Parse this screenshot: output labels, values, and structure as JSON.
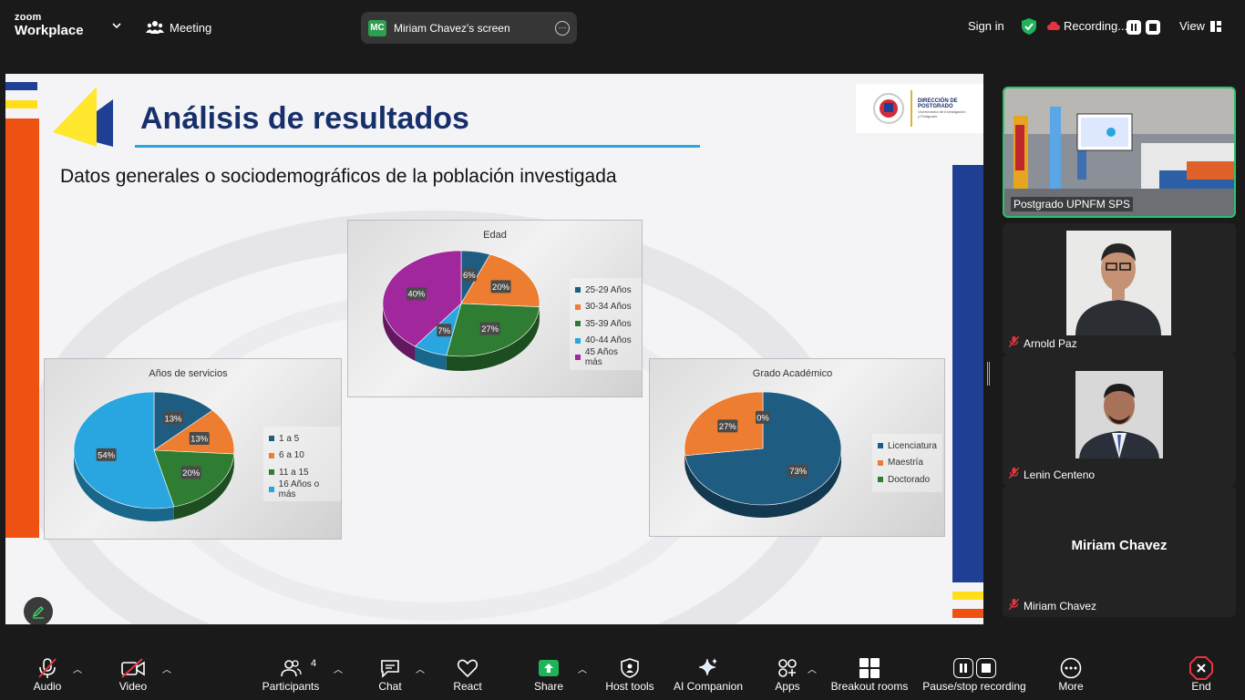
{
  "topbar": {
    "brand_top": "zoom",
    "brand_bottom": "Workplace",
    "meeting_label": "Meeting",
    "screen_initials": "MC",
    "screen_label": "Miriam Chavez's screen",
    "sign_in": "Sign in",
    "recording_label": "Recording...",
    "view_label": "View"
  },
  "slide": {
    "title": "Análisis de resultados",
    "subtitle": "Datos generales o sociodemográficos de la población investigada",
    "logo_line1": "DIRECCIÓN DE",
    "logo_line2": "POSTGRADO",
    "logo_line3": "Vicerrectoría de Investigación",
    "logo_line4": "y Postgrado"
  },
  "chart_data": [
    {
      "type": "pie",
      "title": "Edad",
      "categories": [
        "25-29 Años",
        "30-34 Años",
        "35-39 Años",
        "40-44 Años",
        "45 Años más"
      ],
      "values": [
        6,
        20,
        27,
        7,
        40
      ],
      "labels": [
        "6%",
        "20%",
        "27%",
        "7%",
        "40%"
      ],
      "colors": [
        "#1f5c82",
        "#ed7d31",
        "#2e7d32",
        "#29a6e0",
        "#a0289c"
      ],
      "legend": "right"
    },
    {
      "type": "pie",
      "title": "Años de servicios",
      "categories": [
        "1 a 5",
        "6 a 10",
        "11 a 15",
        "16 Años o más"
      ],
      "values": [
        13,
        13,
        20,
        54
      ],
      "labels": [
        "13%",
        "13%",
        "20%",
        "54%"
      ],
      "colors": [
        "#1f5c82",
        "#ed7d31",
        "#2e7d32",
        "#29a6e0"
      ],
      "legend": "right"
    },
    {
      "type": "pie",
      "title": "Grado Académico",
      "categories": [
        "Licenciatura",
        "Maestría",
        "Doctorado"
      ],
      "values": [
        73,
        27,
        0
      ],
      "labels": [
        "73%",
        "27%",
        "0%"
      ],
      "colors": [
        "#1f5c82",
        "#ed7d31",
        "#2e7d32"
      ],
      "legend": "right"
    }
  ],
  "participants": [
    {
      "name": "Postgrado UPNFM SPS"
    },
    {
      "name": "Arnold Paz"
    },
    {
      "name": "Lenin Centeno"
    },
    {
      "name": "Miriam Chavez",
      "big_name": "Miriam Chavez"
    }
  ],
  "toolbar": {
    "audio": "Audio",
    "video": "Video",
    "participants": "Participants",
    "participant_count": "4",
    "chat": "Chat",
    "react": "React",
    "share": "Share",
    "host_tools": "Host tools",
    "ai": "AI Companion",
    "apps": "Apps",
    "breakout": "Breakout rooms",
    "pause_rec": "Pause/stop recording",
    "more": "More",
    "end": "End"
  }
}
